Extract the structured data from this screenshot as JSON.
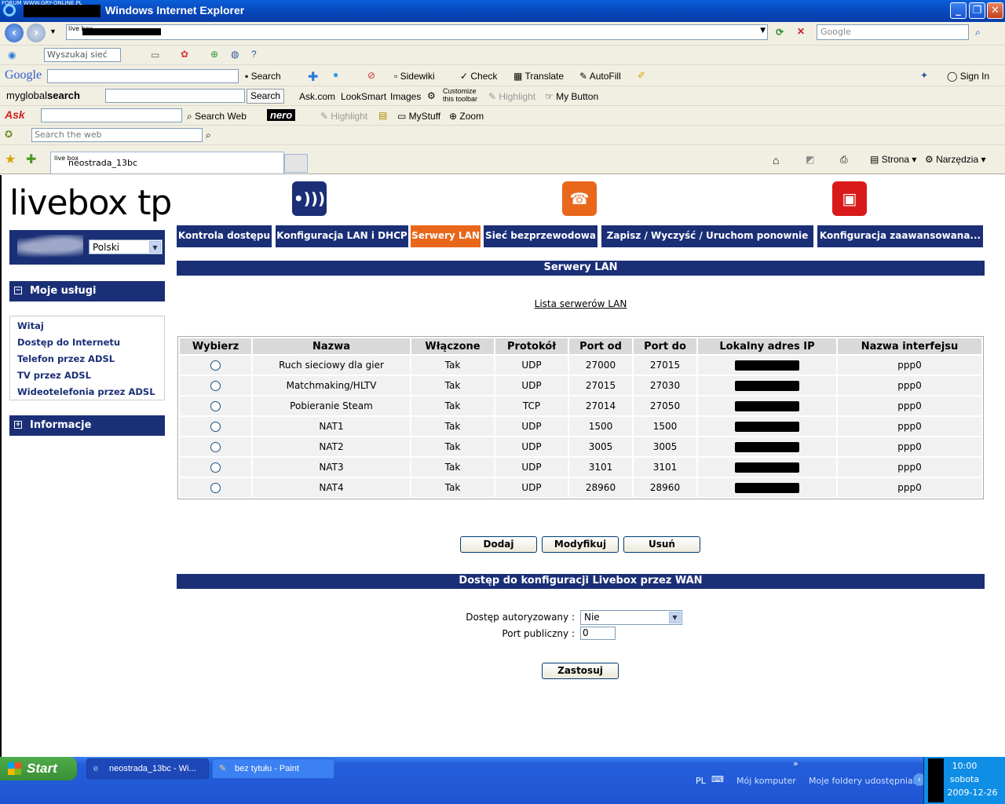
{
  "window": {
    "title": "Windows Internet Explorer",
    "forum_watermark": "FORUM WWW.GRY-ONLINE.PL",
    "minimize": "_",
    "maximize": "❐",
    "close": "✕"
  },
  "address_bar": {
    "favicon_text": "live box",
    "search_placeholder": "Google"
  },
  "toolbars": {
    "row1": {
      "search_placeholder": "Wyszukaj sieć"
    },
    "google": {
      "logo": "Google",
      "search": "Search",
      "sidewiki": "Sidewiki",
      "check": "Check",
      "translate": "Translate",
      "autofill": "AutoFill",
      "sign_in": "Sign In"
    },
    "myglobalsearch": {
      "logo_prefix": "myglobal",
      "logo_suffix": "search",
      "search_btn": "Search",
      "ask": "Ask.com",
      "looksmart": "LookSmart",
      "images": "Images",
      "customize_1": "Customize",
      "customize_2": "this toolbar",
      "highlight": "Highlight",
      "my_button": "My Button"
    },
    "ask": {
      "logo": "Ask",
      "search_web": "Search Web",
      "nero": "nero",
      "highlight": "Highlight",
      "mystuff": "MyStuff",
      "zoom": "Zoom"
    },
    "search_row": {
      "placeholder": "Search the web"
    }
  },
  "tabs": {
    "current": "neostrada_13bc",
    "favicon_text": "live box",
    "strona": "Strona",
    "narzedzia": "Narzędzia"
  },
  "page": {
    "logo": "livebox tp",
    "language": "Polski",
    "sidebar": {
      "section1_title": "Moje usługi",
      "section1_toggle": "−",
      "items": [
        "Witaj",
        "Dostęp do Internetu",
        "Telefon przez ADSL",
        "TV przez ADSL",
        "Wideotelefonia przez ADSL"
      ],
      "section2_title": "Informacje",
      "section2_toggle": "+"
    },
    "nav_tabs": [
      "Kontrola dostępu",
      "Konfiguracja LAN i DHCP",
      "Serwery LAN",
      "Sieć bezprzewodowa",
      "Zapisz / Wyczyść / Uruchom ponownie",
      "Konfiguracja zaawansowana..."
    ],
    "section_title": "Serwery LAN",
    "list_link": "Lista serwerów LAN",
    "table": {
      "headers": [
        "Wybierz",
        "Nazwa",
        "Włączone",
        "Protokół",
        "Port od",
        "Port do",
        "Lokalny adres IP",
        "Nazwa interfejsu"
      ],
      "rows": [
        {
          "name": "Ruch sieciowy dla gier",
          "enabled": "Tak",
          "protocol": "UDP",
          "from": "27000",
          "to": "27015",
          "iface": "ppp0"
        },
        {
          "name": "Matchmaking/HLTV",
          "enabled": "Tak",
          "protocol": "UDP",
          "from": "27015",
          "to": "27030",
          "iface": "ppp0"
        },
        {
          "name": "Pobieranie Steam",
          "enabled": "Tak",
          "protocol": "TCP",
          "from": "27014",
          "to": "27050",
          "iface": "ppp0"
        },
        {
          "name": "NAT1",
          "enabled": "Tak",
          "protocol": "UDP",
          "from": "1500",
          "to": "1500",
          "iface": "ppp0"
        },
        {
          "name": "NAT2",
          "enabled": "Tak",
          "protocol": "UDP",
          "from": "3005",
          "to": "3005",
          "iface": "ppp0"
        },
        {
          "name": "NAT3",
          "enabled": "Tak",
          "protocol": "UDP",
          "from": "3101",
          "to": "3101",
          "iface": "ppp0"
        },
        {
          "name": "NAT4",
          "enabled": "Tak",
          "protocol": "UDP",
          "from": "28960",
          "to": "28960",
          "iface": "ppp0"
        }
      ]
    },
    "buttons": {
      "add": "Dodaj",
      "modify": "Modyfikuj",
      "remove": "Usuń"
    },
    "wan": {
      "title": "Dostęp do konfiguracji Livebox przez WAN",
      "auth_label": "Dostęp autoryzowany :",
      "auth_value": "Nie",
      "port_label": "Port publiczny :",
      "port_value": "0",
      "apply": "Zastosuj"
    }
  },
  "taskbar": {
    "start": "Start",
    "tasks": [
      "neostrada_13bc - Wi...",
      "bez tytułu - Paint"
    ],
    "lang": "PL",
    "my_computer": "Mój komputer",
    "shared": "Moje foldery udostępniania",
    "time": "10:00",
    "day": "sobota",
    "date": "2009-12-26"
  },
  "colors": {
    "nav_blue": "#1b2f77",
    "active_orange": "#e8671b",
    "icon_wifi": "#1b2f77",
    "icon_phone": "#e8671b",
    "icon_tv": "#d91a1a"
  }
}
